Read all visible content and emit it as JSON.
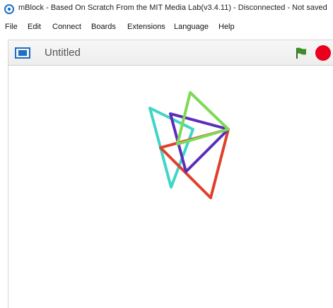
{
  "window": {
    "title": "mBlock - Based On Scratch From the MIT Media Lab(v3.4.11) - Disconnected - Not saved"
  },
  "menu": {
    "items": [
      "File",
      "Edit",
      "Connect",
      "Boards",
      "Extensions",
      "Language",
      "Help"
    ]
  },
  "stage_header": {
    "project_title": "Untitled",
    "flag_icon": "green-flag-icon",
    "stop_icon": "stop-icon"
  },
  "drawing": {
    "colors": {
      "cyan": "#3fd6c6",
      "green": "#7ed957",
      "purple": "#5b2dbd",
      "red": "#e0402a"
    }
  }
}
